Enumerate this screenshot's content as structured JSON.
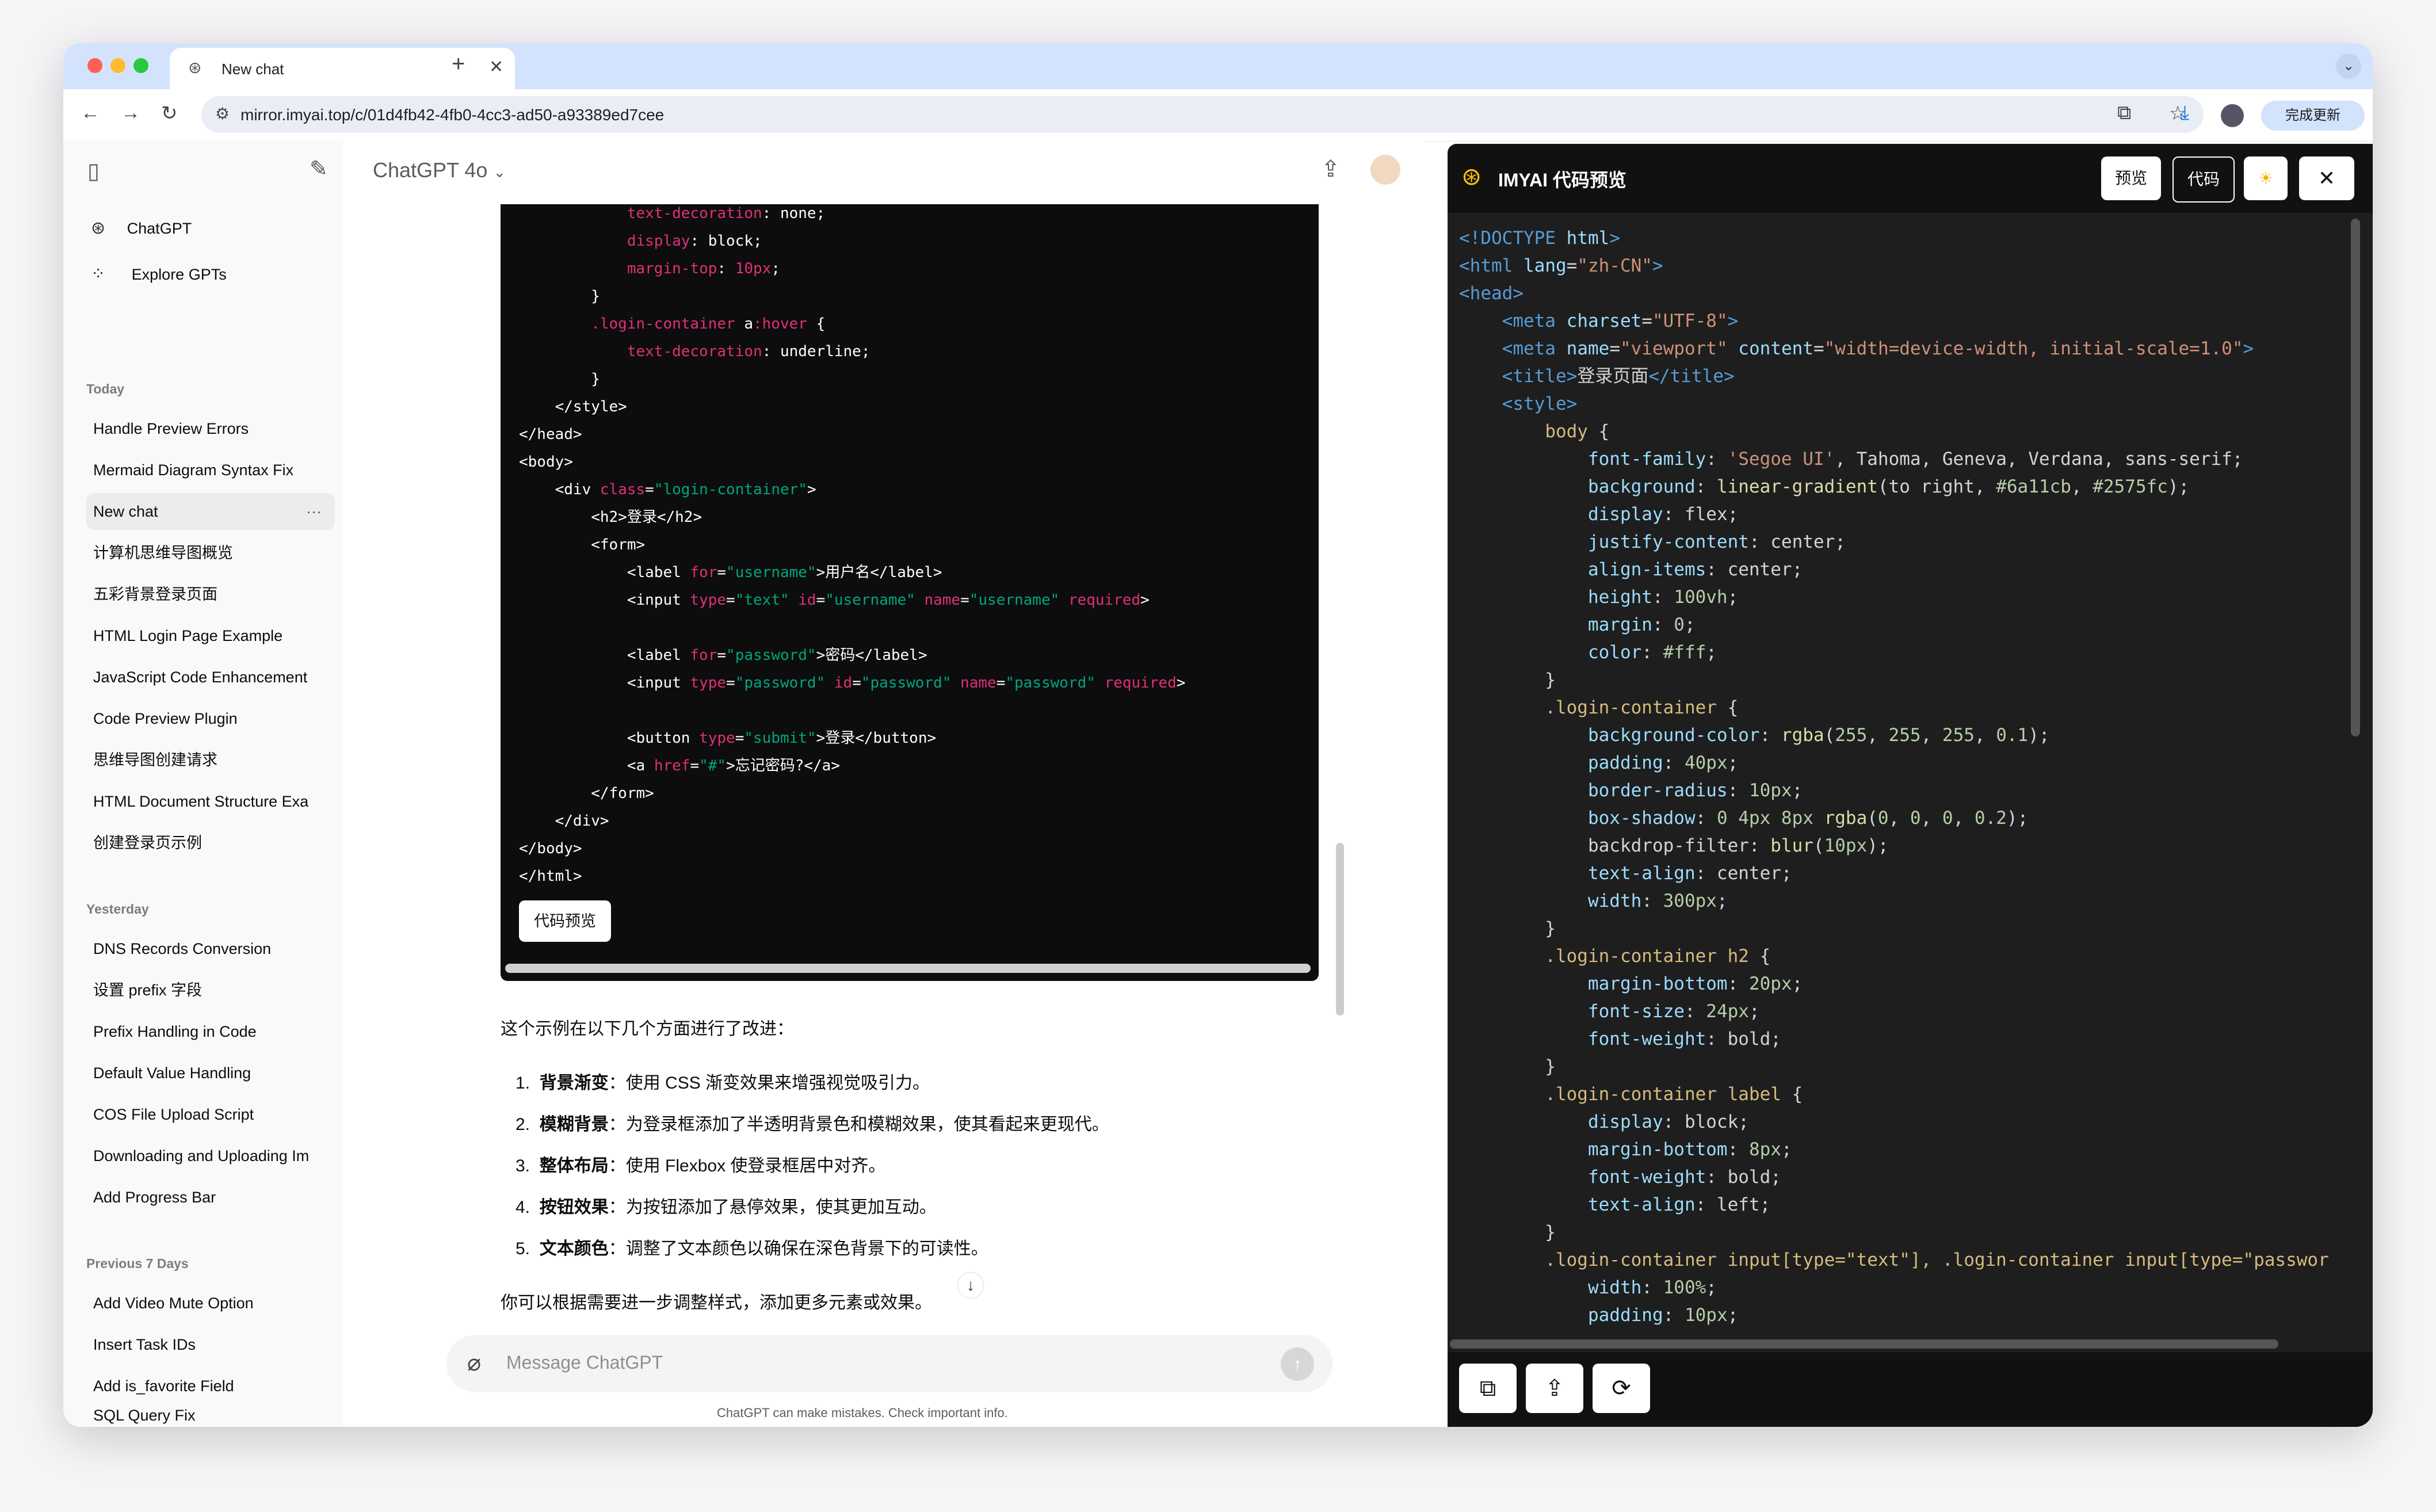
{
  "browser": {
    "tab_title": "New chat",
    "new_tab": "+",
    "url": "mirror.imyai.top/c/01d4fb42-4fb0-4cc3-ad50-a93389ed7cee",
    "update_button": "完成更新"
  },
  "sidebar": {
    "top_items": [
      "ChatGPT",
      "Explore GPTs"
    ],
    "sections": [
      {
        "label": "Today",
        "items": [
          "Handle Preview Errors",
          "Mermaid Diagram Syntax Fix",
          "New chat",
          "计算机思维导图概览",
          "五彩背景登录页面",
          "HTML Login Page Example",
          "JavaScript Code Enhancement",
          "Code Preview Plugin",
          "思维导图创建请求",
          "HTML Document Structure Exa",
          "创建登录页示例"
        ]
      },
      {
        "label": "Yesterday",
        "items": [
          "DNS Records Conversion",
          "设置 prefix 字段",
          "Prefix Handling in Code",
          "Default Value Handling",
          "COS File Upload Script",
          "Downloading and Uploading Im",
          "Add Progress Bar"
        ]
      },
      {
        "label": "Previous 7 Days",
        "items": [
          "Add Video Mute Option",
          "Insert Task IDs",
          "Add is_favorite Field",
          "SQL Query Fix"
        ]
      }
    ],
    "active_item": "New chat",
    "more_dots": "···"
  },
  "chat": {
    "model": "ChatGPT 4o",
    "preview_button": "代码预览",
    "intro": "这个示例在以下几个方面进行了改进：",
    "points": [
      {
        "num": "1.",
        "title": "背景渐变",
        "text": "：使用 CSS 渐变效果来增强视觉吸引力。"
      },
      {
        "num": "2.",
        "title": "模糊背景",
        "text": "：为登录框添加了半透明背景色和模糊效果，使其看起来更现代。"
      },
      {
        "num": "3.",
        "title": "整体布局",
        "text": "：使用 Flexbox 使登录框居中对齐。"
      },
      {
        "num": "4.",
        "title": "按钮效果",
        "text": "：为按钮添加了悬停效果，使其更加互动。"
      },
      {
        "num": "5.",
        "title": "文本颜色",
        "text": "：调整了文本颜色以确保在深色背景下的可读性。"
      }
    ],
    "outro": "你可以根据需要进一步调整样式，添加更多元素或效果。",
    "composer_placeholder": "Message ChatGPT",
    "disclaimer": "ChatGPT can make mistakes. Check important info."
  },
  "panel": {
    "title": "IMYAI 代码预览",
    "preview_tab": "预览",
    "code_tab": "代码",
    "close": "✕"
  }
}
